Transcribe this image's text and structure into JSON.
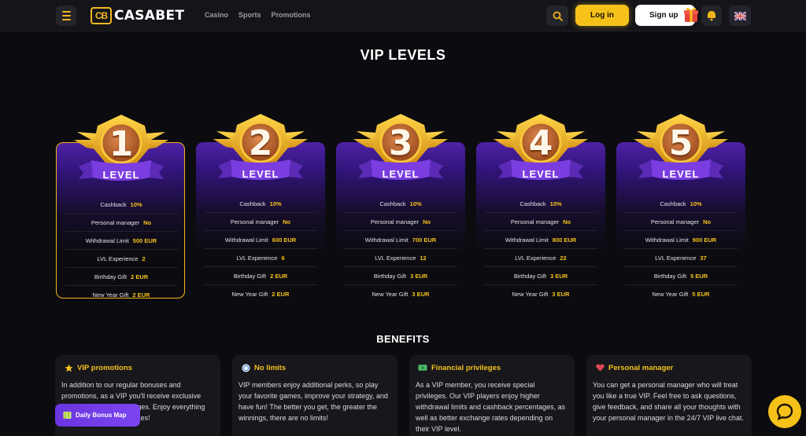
{
  "header": {
    "logo_mark": "CB",
    "logo_text": "CASABET",
    "nav": [
      "Casino",
      "Sports",
      "Promotions"
    ],
    "login_label": "Log in",
    "signup_label": "Sign up",
    "icons": [
      "menu-icon",
      "search-icon",
      "gift-icon",
      "chat-notification-icon",
      "uk-flag-icon"
    ]
  },
  "page_title": "VIP LEVELS",
  "levels": [
    {
      "number": "1",
      "badge": "LEVEL",
      "rows": [
        {
          "k": "Cashback",
          "v": "10%"
        },
        {
          "k": "Personal manager",
          "v": "No"
        },
        {
          "k": "Withdrawal Limit",
          "v": "500 EUR"
        },
        {
          "k": "LVL Experience",
          "v": "2"
        },
        {
          "k": "Birthday Gift",
          "v": "2 EUR"
        },
        {
          "k": "New Year Gift",
          "v": "2 EUR"
        }
      ]
    },
    {
      "number": "2",
      "badge": "LEVEL",
      "rows": [
        {
          "k": "Cashback",
          "v": "10%"
        },
        {
          "k": "Personal manager",
          "v": "No"
        },
        {
          "k": "Withdrawal Limit",
          "v": "600 EUR"
        },
        {
          "k": "LVL Experience",
          "v": "6"
        },
        {
          "k": "Birthday Gift",
          "v": "2 EUR"
        },
        {
          "k": "New Year Gift",
          "v": "2 EUR"
        }
      ]
    },
    {
      "number": "3",
      "badge": "LEVEL",
      "rows": [
        {
          "k": "Cashback",
          "v": "10%"
        },
        {
          "k": "Personal manager",
          "v": "No"
        },
        {
          "k": "Withdrawal Limit",
          "v": "700 EUR"
        },
        {
          "k": "LVL Experience",
          "v": "12"
        },
        {
          "k": "Birthday Gift",
          "v": "3 EUR"
        },
        {
          "k": "New Year Gift",
          "v": "3 EUR"
        }
      ]
    },
    {
      "number": "4",
      "badge": "LEVEL",
      "rows": [
        {
          "k": "Cashback",
          "v": "10%"
        },
        {
          "k": "Personal manager",
          "v": "No"
        },
        {
          "k": "Withdrawal Limit",
          "v": "800 EUR"
        },
        {
          "k": "LVL Experience",
          "v": "22"
        },
        {
          "k": "Birthday Gift",
          "v": "3 EUR"
        },
        {
          "k": "New Year Gift",
          "v": "3 EUR"
        }
      ]
    },
    {
      "number": "5",
      "badge": "LEVEL",
      "rows": [
        {
          "k": "Cashback",
          "v": "10%"
        },
        {
          "k": "Personal manager",
          "v": "No"
        },
        {
          "k": "Withdrawal Limit",
          "v": "900 EUR"
        },
        {
          "k": "LVL Experience",
          "v": "37"
        },
        {
          "k": "Birthday Gift",
          "v": "5 EUR"
        },
        {
          "k": "New Year Gift",
          "v": "5 EUR"
        }
      ]
    }
  ],
  "benefits_title": "BENEFITS",
  "benefits": [
    {
      "icon": "star-icon",
      "title": "VIP promotions",
      "text": "In addition to our regular bonuses and promotions, as a VIP you'll receive exclusive offers and special privileges. Enjoy everything you have many advantages!"
    },
    {
      "icon": "no-limit-icon",
      "title": "No limits",
      "text": "VIP members enjoy additional perks, so play your favorite games, improve your strategy, and have fun! The better you get, the greater the winnings, there are no limits!"
    },
    {
      "icon": "money-icon",
      "title": "Financial privileges",
      "text": "As a VIP member, you receive special privileges. Our VIP players enjoy higher withdrawal limits and cashback percentages, as well as better exchange rates depending on their VIP level."
    },
    {
      "icon": "heart-icon",
      "title": "Personal manager",
      "text": "You can get a personal manager who will treat you like a true VIP. Feel free to ask questions, give feedback, and share all your thoughts with your personal manager in the 24/7 VIP live chat."
    }
  ],
  "bonus_map_label": "Daily Bonus Map",
  "colors": {
    "accent": "#f6c21a",
    "purple": "#4f21a6",
    "bg": "#0c0c10"
  }
}
